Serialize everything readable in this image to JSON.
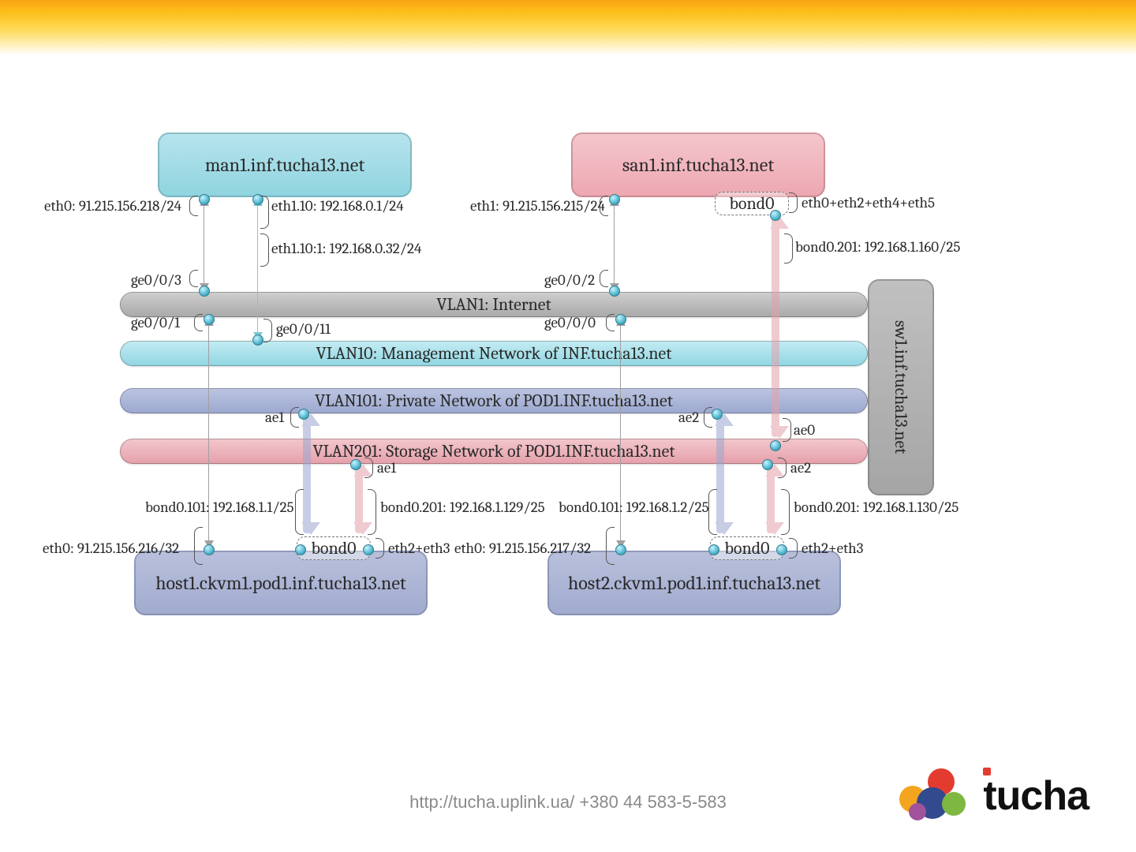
{
  "footer": "http://tucha.uplink.ua/ +380 44 583-5-583",
  "brand": "tucha",
  "nodes": {
    "man1": "man1.inf.tucha13.net",
    "san1": "san1.inf.tucha13.net",
    "host1": "host1.ckvm1.pod1.inf.tucha13.net",
    "host2": "host2.ckvm1.pod1.inf.tucha13.net",
    "sw1": "sw1.inf.tucha13.net"
  },
  "bond_label": "bond0",
  "bars": {
    "vlan1": "VLAN1: Internet",
    "vlan10": "VLAN10: Management Network of INF.tucha13.net",
    "vlan101": "VLAN101: Private Network of POD1.INF.tucha13.net",
    "vlan201": "VLAN201: Storage Network of POD1.INF.tucha13.net"
  },
  "ifaces": {
    "man1_eth0": "eth0: 91.215.156.218/24",
    "man1_eth1_10": "eth1.10: 192.168.0.1/24",
    "man1_eth1_10_1": "eth1.10:1: 192.168.0.32/24",
    "san1_eth1": "eth1: 91.215.156.215/24",
    "san1_bond_mix": "eth0+eth2+eth4+eth5",
    "san1_bond201": "bond0.201: 192.168.1.160/25",
    "host1_eth0": "eth0: 91.215.156.216/32",
    "host1_b101": "bond0.101: 192.168.1.1/25",
    "host1_b201": "bond0.201: 192.168.1.129/25",
    "host1_bondmix": "eth2+eth3",
    "host2_eth0": "eth0: 91.215.156.217/32",
    "host2_b101": "bond0.101: 192.168.1.2/25",
    "host2_b201": "bond0.201: 192.168.1.130/25",
    "host2_bondmix": "eth2+eth3"
  },
  "ports": {
    "ge003": "ge0/0/3",
    "ge001": "ge0/0/1",
    "ge0011": "ge0/0/11",
    "ge002": "ge0/0/2",
    "ge000": "ge0/0/0",
    "ae0": "ae0",
    "ae1_t": "ae1",
    "ae1_b": "ae1",
    "ae2_t": "ae2",
    "ae2_b": "ae2"
  }
}
